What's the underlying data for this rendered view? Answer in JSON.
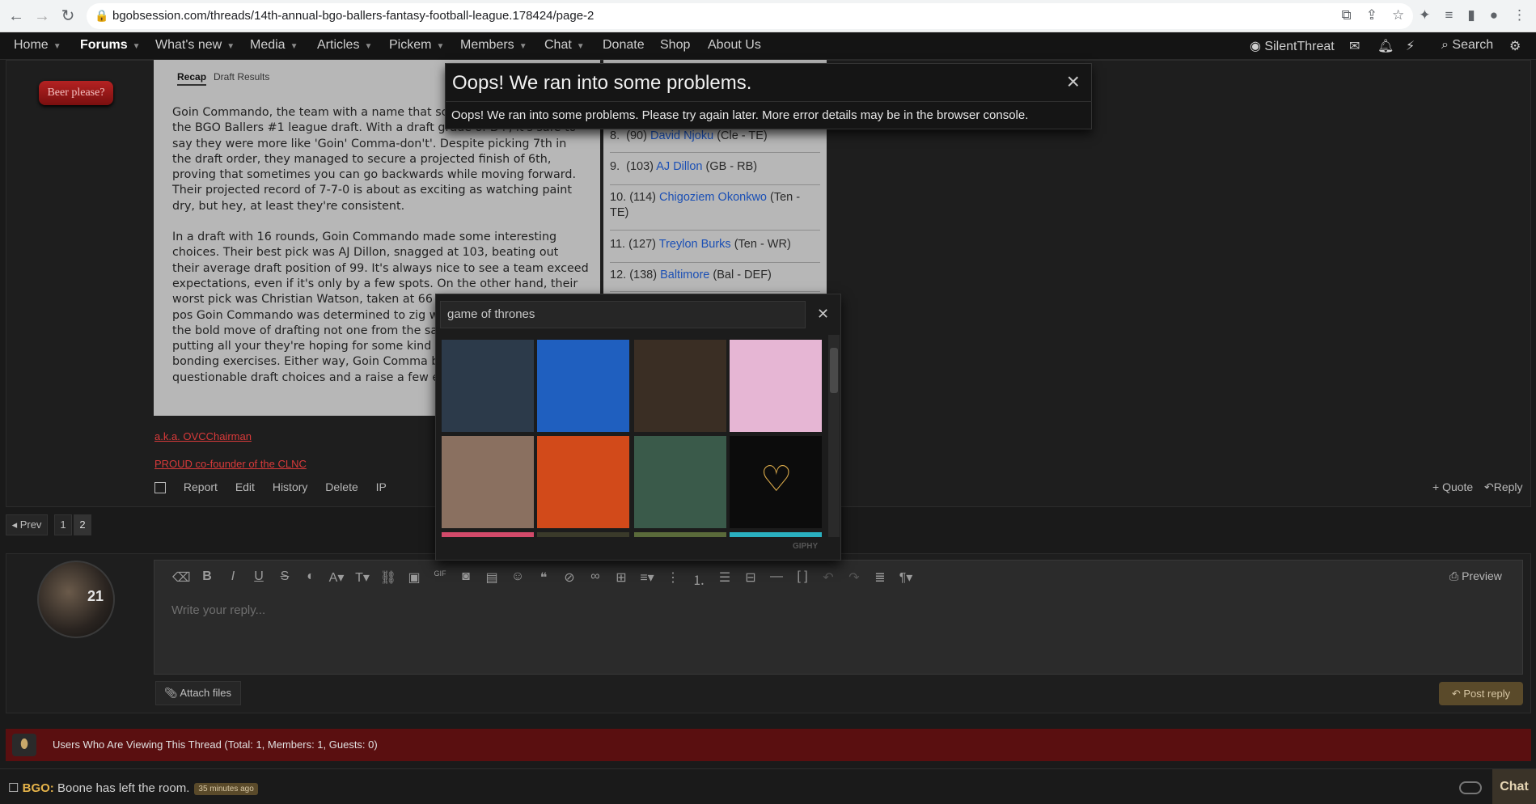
{
  "browser": {
    "url": "bgobsession.com/threads/14th-annual-bgo-ballers-fantasy-football-league.178424/page-2"
  },
  "nav": {
    "items": [
      "Home",
      "Forums",
      "What's new",
      "Media",
      "Articles",
      "Pickem",
      "Members",
      "Chat",
      "Donate",
      "Shop",
      "About Us"
    ],
    "user": "SilentThreat",
    "search": "Search"
  },
  "sidebar": {
    "beer_button": "Beer please?"
  },
  "recap": {
    "tabs": [
      "Recap",
      "Draft Results"
    ],
    "paragraphs": [
      "Goin Commando, the team with a name that screams took the field in the BGO Ballers #1 league draft. With a draft grade of D+, it's safe to say they were more like 'Goin' Comma-don't'. Despite picking 7th in the draft order, they managed to secure a projected finish of 6th, proving that sometimes you can go backwards while moving forward. Their projected record of 7-7-0 is about as exciting as watching paint dry, but hey, at least they're consistent.",
      "In a draft with 16 rounds, Goin Commando made some interesting choices. Their best pick was AJ Dillon, snagged at 103, beating out their average draft position of 99. It's always nice to see a team exceed expectations, even if it's only by a few spots. On the other hand, their worst pick was Christian Watson, taken at 66 when their average draft pos Goin Commando was determined to zig when eve let's not forget the bold move of drafting not one from the same team. Talk about putting all your they're hoping for some kind of magical synergy, team bonding exercises. Either way, Goin Comma battle with their questionable draft choices and a raise a few eyebrows."
    ]
  },
  "picks": [
    {
      "num": "8.",
      "pick": "(90)",
      "player": "David Njoku",
      "team": "(Cle - TE)"
    },
    {
      "num": "9.",
      "pick": "(103)",
      "player": "AJ Dillon",
      "team": "(GB - RB)"
    },
    {
      "num": "10.",
      "pick": "(114)",
      "player": "Chigoziem Okonkwo",
      "team": "(Ten - TE)"
    },
    {
      "num": "11.",
      "pick": "(127)",
      "player": "Treylon Burks",
      "team": "(Ten - WR)"
    },
    {
      "num": "12.",
      "pick": "(138)",
      "player": "Baltimore",
      "team": "(Bal - DEF)"
    }
  ],
  "signature": {
    "line1": "a.k.a. OVCChairman",
    "line2": "PROUD co-founder of the CLNC"
  },
  "post_actions": [
    "Report",
    "Edit",
    "History",
    "Delete",
    "IP"
  ],
  "post_right_actions": {
    "quote": "+ Quote",
    "reply": "Reply"
  },
  "pagination": {
    "prev": "◂ Prev",
    "pages": [
      "1",
      "2"
    ]
  },
  "editor": {
    "placeholder": "Write your reply...",
    "preview": "Preview",
    "attach": "Attach files",
    "post_reply": "Post reply"
  },
  "avatar_number": "21",
  "viewers": "Users Who Are Viewing This Thread (Total: 1, Members: 1, Guests: 0)",
  "chat": {
    "user": "BGO:",
    "message": "Boone has left the room.",
    "time": "35 minutes ago",
    "button": "Chat"
  },
  "error": {
    "title": "Oops! We ran into some problems.",
    "body": "Oops! We ran into some problems. Please try again later. More error details may be in the browser console."
  },
  "gif": {
    "search_value": "game of thrones",
    "brand": "GIPHY",
    "tile_colors": [
      "#2c3a4a",
      "#1f5fbf",
      "#3a2e24",
      "#e6b6d4",
      "#8a7060",
      "#d24a1a",
      "#3a5a4a",
      "#0c0c0c"
    ]
  },
  "colors": {
    "accent_red": "#5a0f10",
    "link_blue": "#1a4fb5",
    "sig_red": "#d93a3a"
  }
}
